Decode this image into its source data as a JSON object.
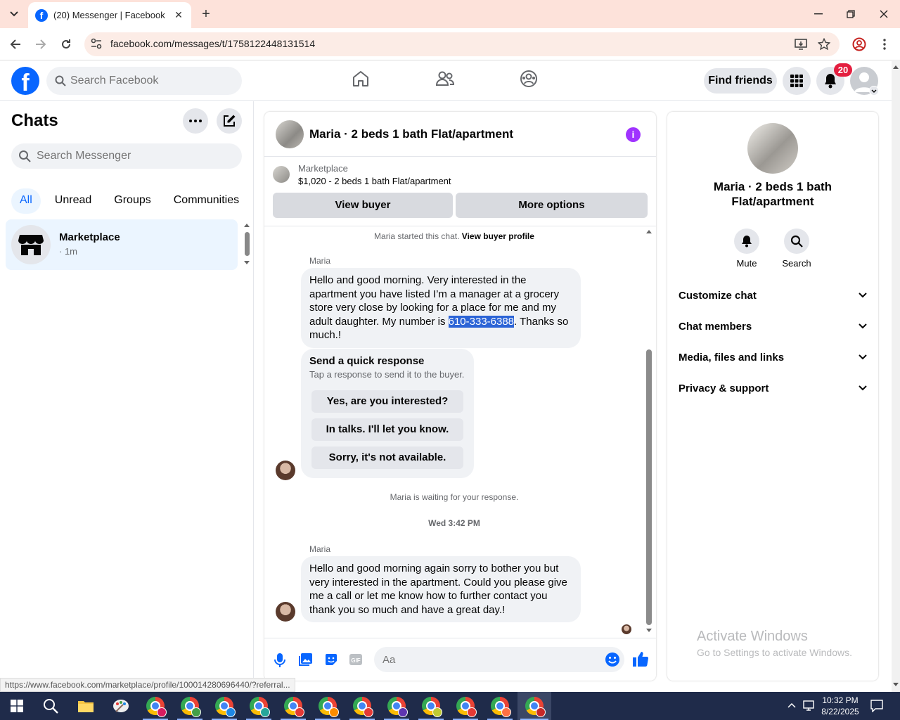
{
  "browser": {
    "tab_title": "(20) Messenger | Facebook",
    "url": "facebook.com/messages/t/1758122448131514",
    "status_url": "https://www.facebook.com/marketplace/profile/100014280696440/?referral..."
  },
  "header": {
    "search_placeholder": "Search Facebook",
    "find_friends": "Find friends",
    "notifications_count": "20",
    "brand_color": "#0866ff"
  },
  "sidebar": {
    "title": "Chats",
    "search_placeholder": "Search Messenger",
    "filters": [
      "All",
      "Unread",
      "Groups",
      "Communities"
    ],
    "active_filter": "All",
    "chats": [
      {
        "name": "Marketplace",
        "time": "· 1m"
      }
    ]
  },
  "conversation": {
    "title": "Maria · 2 beds 1 bath Flat/apartment",
    "marketplace_label": "Marketplace",
    "listing": "$1,020 - 2 beds 1 bath Flat/apartment",
    "view_buyer": "View buyer",
    "more_options": "More options",
    "started_text": "Maria started this chat.",
    "view_buyer_profile": "View buyer profile",
    "msg1": {
      "sender": "Maria",
      "text_before": "Hello and good morning. Very interested in the apartment you have listed I’m a manager at a grocery store very close by looking for a place for me and my adult daughter. My number is ",
      "highlight": "610-333-6388",
      "text_after": ". Thanks so much.!"
    },
    "quick_response": {
      "title": "Send a quick response",
      "subtitle": "Tap a response to send it to the buyer.",
      "options": [
        "Yes, are you interested?",
        "In talks. I'll let you know.",
        "Sorry, it's not available."
      ]
    },
    "waiting_text": "Maria is waiting for your response.",
    "timestamp": "Wed 3:42 PM",
    "msg2": {
      "sender": "Maria",
      "text": "Hello and good morning again sorry to bother you but very interested in the apartment. Could you please give me a call or let me know how to further contact you thank you so much and have a great day.!"
    },
    "composer_placeholder": "Aa"
  },
  "info_panel": {
    "name": "Maria · 2 beds 1 bath Flat/apartment",
    "actions": [
      "Mute",
      "Search"
    ],
    "sections": [
      "Customize chat",
      "Chat members",
      "Media, files and links",
      "Privacy & support"
    ]
  },
  "watermark": {
    "line1": "Activate Windows",
    "line2": "Go to Settings to activate Windows."
  },
  "taskbar": {
    "time": "10:32 PM",
    "date": "8/22/2025"
  }
}
